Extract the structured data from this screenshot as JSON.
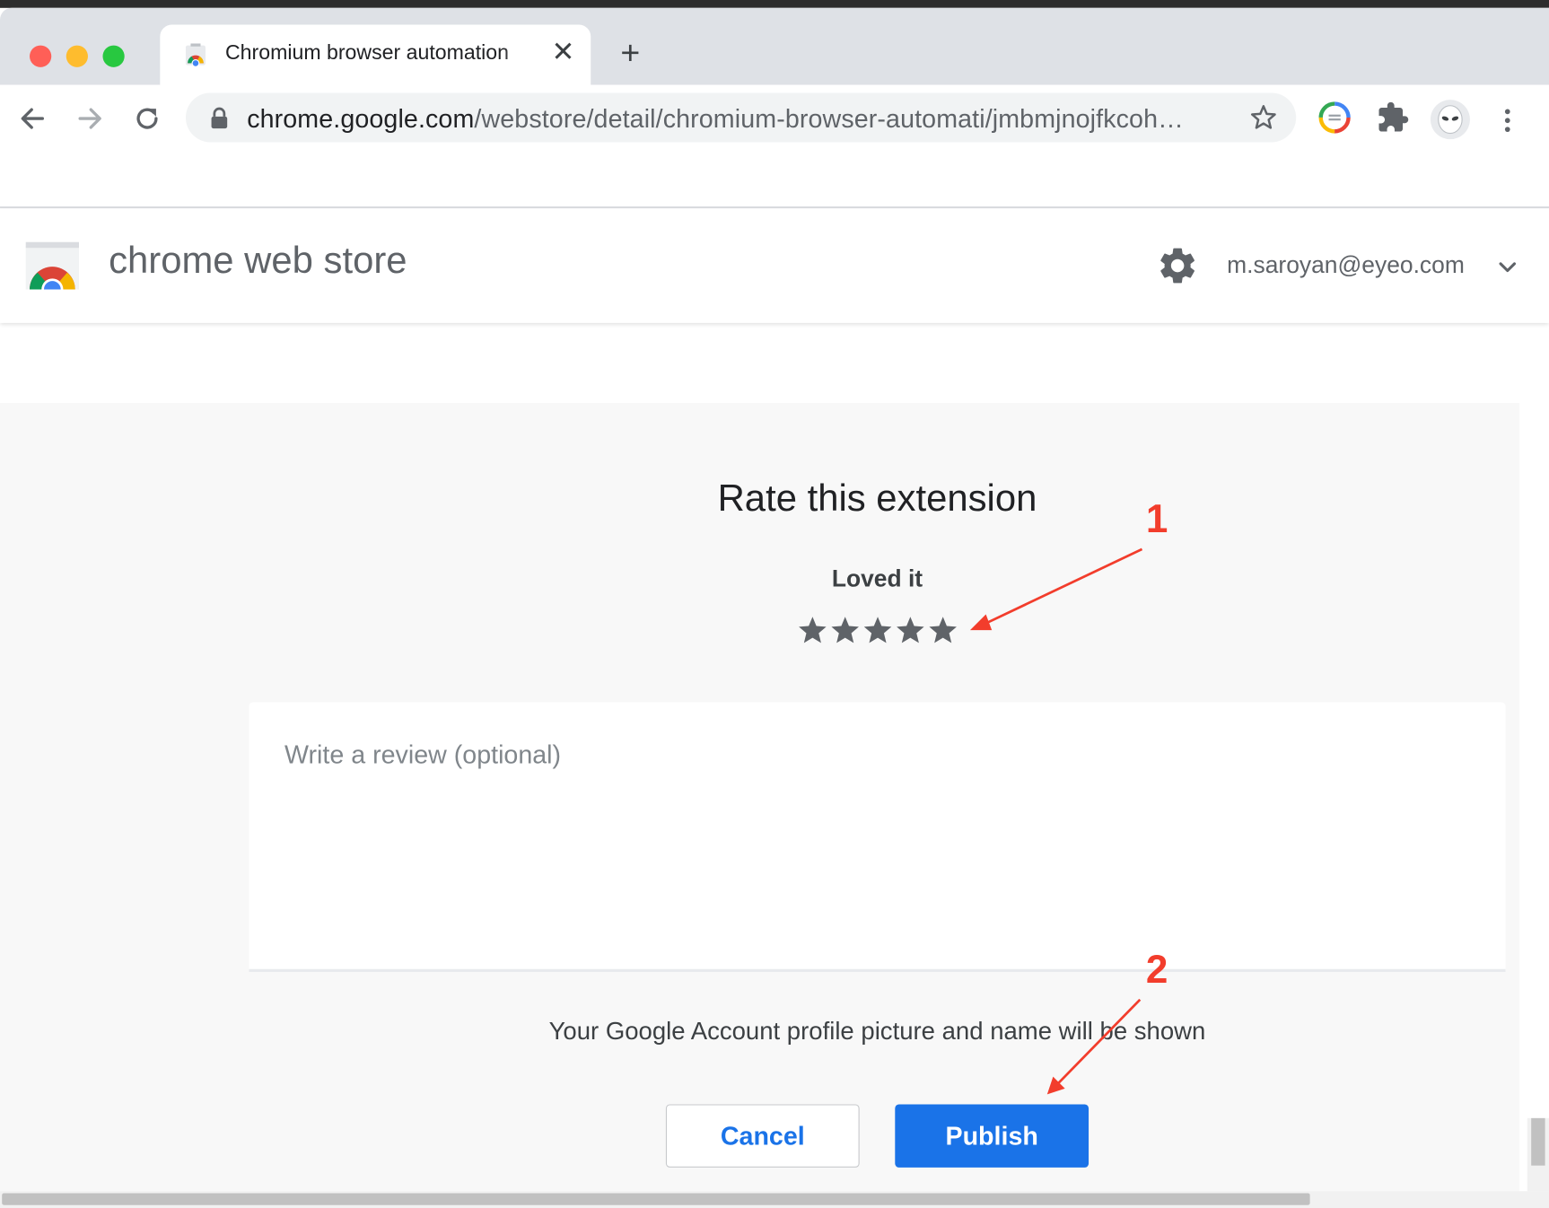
{
  "window": {
    "traffic_lights": {
      "close_color": "#ff5f57",
      "minimize_color": "#febc2e",
      "zoom_color": "#28c840"
    }
  },
  "tab": {
    "title": "Chromium browser automation",
    "close_glyph": "✕"
  },
  "new_tab_glyph": "+",
  "toolbar": {
    "url_host": "chrome.google.com",
    "url_path": "/webstore/detail/chromium-browser-automati/jmbmjnojfkcoh…"
  },
  "store": {
    "title": "chrome web store",
    "account": "m.saroyan@eyeo.com"
  },
  "rating": {
    "heading": "Rate this extension",
    "label": "Loved it",
    "stars_selected": 5,
    "stars_total": 5,
    "review_placeholder": "Write a review (optional)",
    "review_value": "",
    "notice": "Your Google Account profile picture and name will be shown",
    "cancel_label": "Cancel",
    "publish_label": "Publish"
  },
  "annotations": {
    "first_marker": "1",
    "second_marker": "2",
    "color": "#f23d2c"
  },
  "colors": {
    "accent_blue": "#1a73e8",
    "star_gray": "#5f6368"
  },
  "icons": [
    "back-arrow-icon",
    "forward-arrow-icon",
    "reload-icon",
    "lock-icon",
    "bookmark-star-icon",
    "extension-color-icon",
    "puzzle-icon",
    "profile-avatar-icon",
    "kebab-menu-icon",
    "settings-gear-icon",
    "chevron-down-icon",
    "chrome-web-store-logo",
    "star-icon"
  ]
}
